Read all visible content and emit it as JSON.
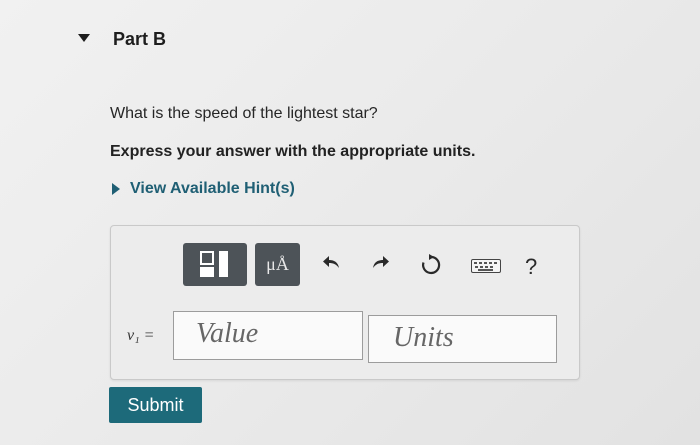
{
  "part": {
    "title": "Part B"
  },
  "question": {
    "text": "What is the speed of the lightest star?"
  },
  "instruction": {
    "text": "Express your answer with the appropriate units."
  },
  "hint": {
    "label": "View Available Hint(s)"
  },
  "toolbar": {
    "units_label": "μÅ",
    "help_label": "?",
    "icons": [
      "templates-icon",
      "units-icon",
      "undo-icon",
      "redo-icon",
      "reset-icon",
      "keyboard-icon",
      "help-icon"
    ]
  },
  "answer": {
    "variable": "v₁ =",
    "value_placeholder": "Value",
    "units_placeholder": "Units"
  },
  "submit": {
    "label": "Submit"
  }
}
